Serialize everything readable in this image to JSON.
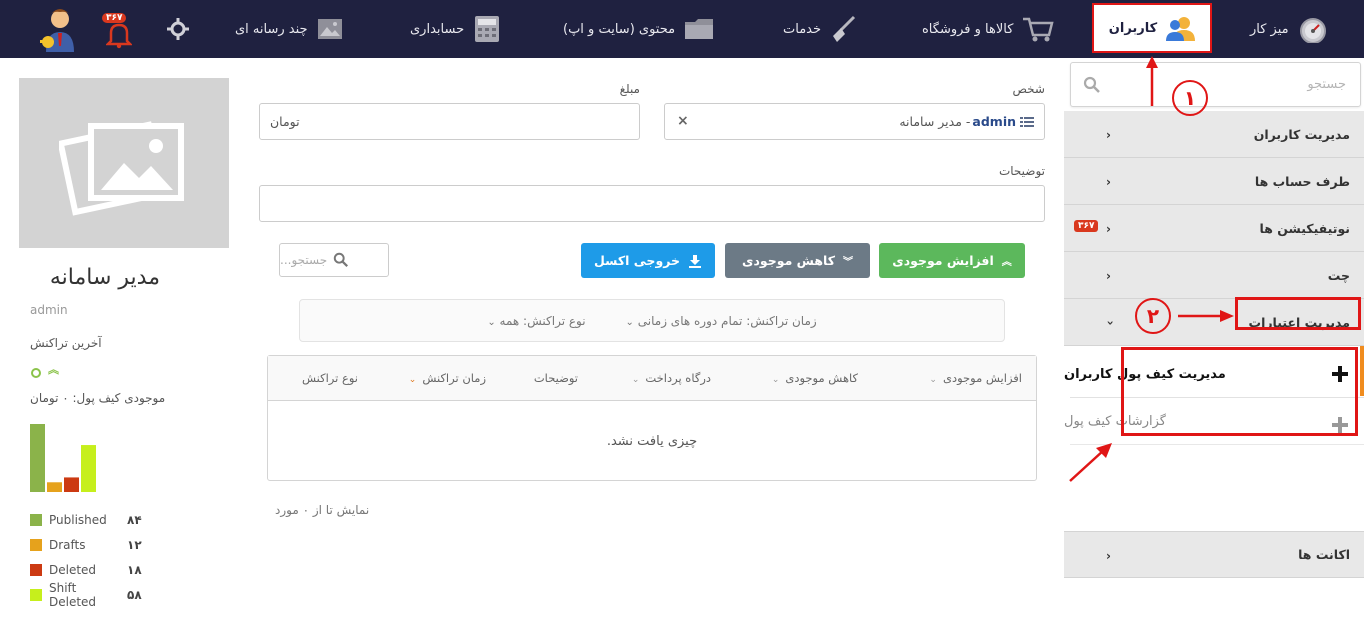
{
  "nav": {
    "dashboard": "میز کار",
    "users": "کاربران",
    "shop": "کالاها و فروشگاه",
    "services": "خدمات",
    "content": "محتوی (سایت و اپ)",
    "accounting": "حسابداری",
    "multimedia": "چند رسانه ای",
    "notif_count": "۳۶۷"
  },
  "sidebar": {
    "search_placeholder": "جستجو",
    "items": [
      {
        "label": "مدیریت کاربران"
      },
      {
        "label": "طرف حساب ها"
      },
      {
        "label": "نوتیفیکیشن ها",
        "badge": "۳۶۷"
      },
      {
        "label": "چت"
      },
      {
        "label": "مدیریت اعتبارات"
      }
    ],
    "sub_items": [
      {
        "label": "مدیریت کیف پول کاربران"
      },
      {
        "label": "گزارشات کیف پول"
      }
    ],
    "accounts": "اکانت ها",
    "annotation_1": "١",
    "annotation_2": "٢"
  },
  "profile": {
    "name": "مدیر سامانه",
    "username": "admin",
    "last_tx_label": "آخرین تراکنش",
    "wallet": "موجودی کیف پول: ۰ تومان",
    "legend": [
      {
        "name": "Published",
        "value": "۸۴",
        "color": "#8bb34a"
      },
      {
        "name": "Drafts",
        "value": "۱۲",
        "color": "#e6a21c"
      },
      {
        "name": "Deleted",
        "value": "۱۸",
        "color": "#cc3a12"
      },
      {
        "name": "Shift Deleted",
        "value": "۵۸",
        "color": "#c6ef1c"
      }
    ],
    "chart_values": [
      84,
      12,
      18,
      58
    ]
  },
  "form": {
    "person_label": "شخص",
    "person_user": "admin",
    "person_name": " - مدیر سامانه",
    "amount_label": "مبلغ",
    "amount_unit": "تومان",
    "desc_label": "توضیحات",
    "btn_increase": "افزایش موجودی",
    "btn_decrease": "کاهش موجودی",
    "btn_excel": "خروجی اکسل",
    "grid_search_placeholder": "جستجو..."
  },
  "filters": {
    "time": "زمان تراکنش: تمام دوره های زمانی",
    "type": "نوع تراکنش:  همه"
  },
  "table": {
    "columns": [
      "افزایش موجودی",
      "کاهش موجودی",
      "درگاه پرداخت",
      "توضیحات",
      "زمان تراکنش",
      "نوع تراکنش"
    ],
    "empty": "چیزی یافت نشد.",
    "pager": "نمایش تا از ۰ مورد"
  }
}
